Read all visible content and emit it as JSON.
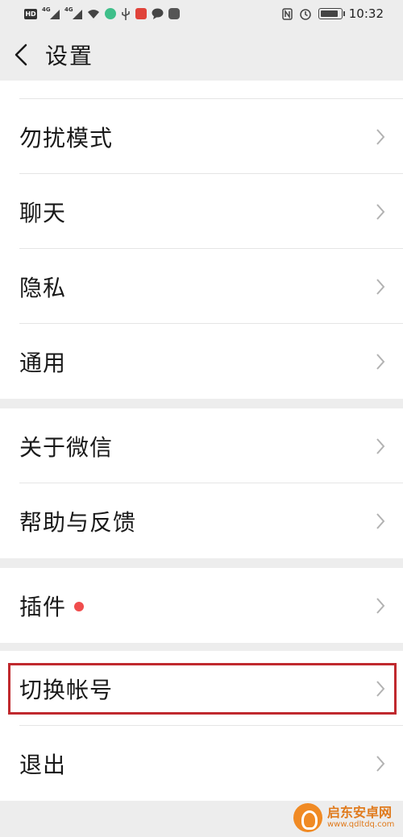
{
  "status_bar": {
    "hd_badge": "HD",
    "signal_1_label": "4G",
    "signal_2_label": "4G",
    "time": "10:32",
    "battery_level": 0.9
  },
  "header": {
    "title": "设置"
  },
  "groups": [
    {
      "items": [
        {
          "label": "勿扰模式"
        },
        {
          "label": "聊天"
        },
        {
          "label": "隐私"
        },
        {
          "label": "通用"
        }
      ]
    },
    {
      "items": [
        {
          "label": "关于微信"
        },
        {
          "label": "帮助与反馈"
        }
      ]
    },
    {
      "items": [
        {
          "label": "插件",
          "has_red_dot": true
        }
      ]
    },
    {
      "items": [
        {
          "label": "切换帐号",
          "highlighted": true
        },
        {
          "label": "退出"
        }
      ]
    }
  ],
  "watermark": {
    "name": "启东安卓网",
    "url": "www.qdltdq.com"
  },
  "colors": {
    "page_background": "#ededed",
    "row_background": "#ffffff",
    "text": "#191919",
    "chevron": "#b2b2b2",
    "red_dot": "#f04d4d",
    "highlight_border": "#c0292e"
  }
}
